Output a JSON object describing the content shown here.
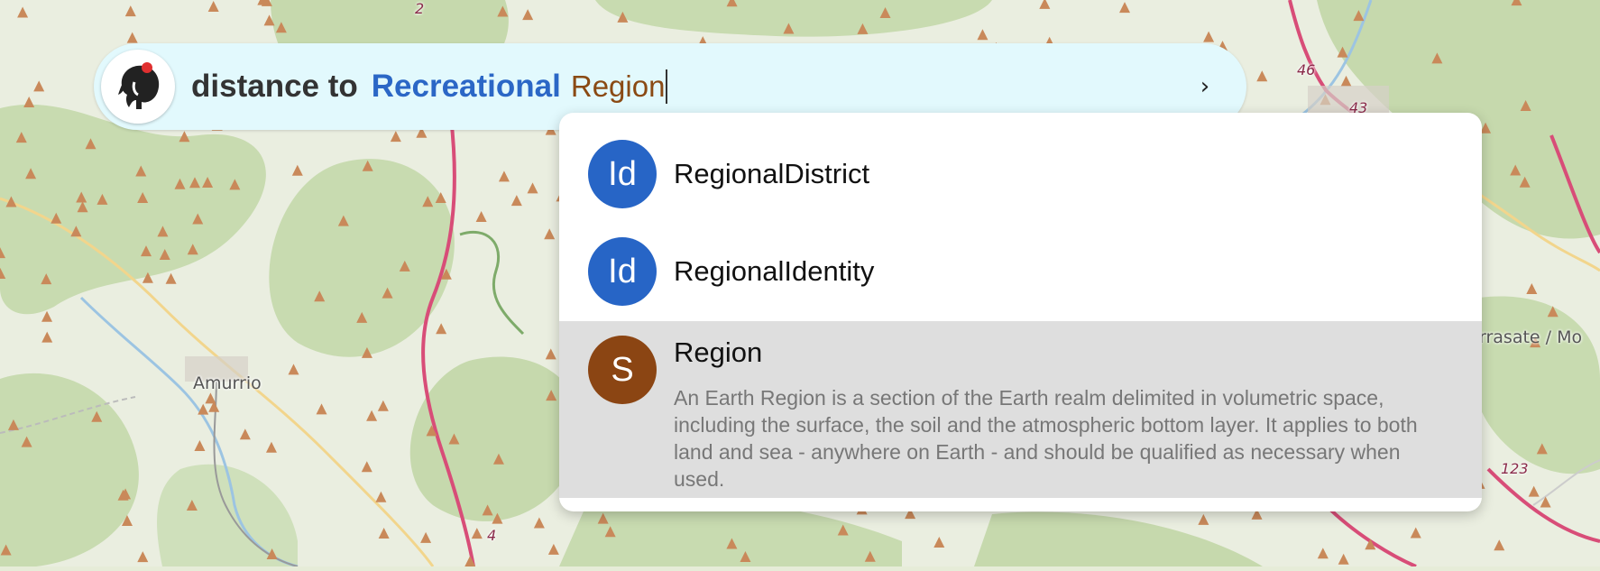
{
  "map": {
    "places": [
      "Amurrio",
      "rrasate / Mo"
    ],
    "road_numbers": [
      "2",
      "46",
      "43",
      "4",
      "123"
    ]
  },
  "search": {
    "logo_icon": "elephant-logo-icon",
    "prefix": "distance to",
    "keyword": "Recreational",
    "input_value": "Region",
    "go_symbol": "›"
  },
  "suggestions": [
    {
      "badge": "Id",
      "badge_color": "#2765c6",
      "title": "RegionalDistrict",
      "description": ""
    },
    {
      "badge": "Id",
      "badge_color": "#2765c6",
      "title": "RegionalIdentity",
      "description": ""
    },
    {
      "badge": "S",
      "badge_color": "#8b4513",
      "title": "Region",
      "description": "An Earth Region is a section of the Earth realm delimited in volumetric space, including the surface, the soil and the atmospheric bottom layer. It applies to both land and sea - anywhere on Earth - and should be qualified as necessary when used.",
      "selected": true
    }
  ]
}
